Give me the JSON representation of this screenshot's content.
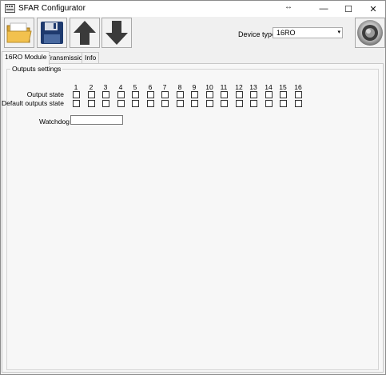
{
  "window": {
    "title": "SFAR Configurator",
    "resize_glyph": "↔",
    "controls": {
      "minimize": "—",
      "maximize": "☐",
      "close": "✕"
    }
  },
  "toolbar": {
    "buttons": [
      {
        "name": "open",
        "icon": "folder-open-icon"
      },
      {
        "name": "save",
        "icon": "floppy-disk-icon"
      },
      {
        "name": "upload",
        "icon": "arrow-up-icon"
      },
      {
        "name": "download",
        "icon": "arrow-down-icon"
      }
    ],
    "device_type_label": "Device type:",
    "device_type_value": "16RO",
    "device_type_arrow": "▾"
  },
  "tabs": [
    {
      "label": "16RO Module",
      "active": true
    },
    {
      "label": "Transmission",
      "active": false
    },
    {
      "label": "Info",
      "active": false
    }
  ],
  "outputs_settings": {
    "title": "Outputs settings",
    "columns": [
      "1",
      "2",
      "3",
      "4",
      "5",
      "6",
      "7",
      "8",
      "9",
      "10",
      "11",
      "12",
      "13",
      "14",
      "15",
      "16"
    ],
    "rows": [
      {
        "label": "Output state",
        "checked": [
          false,
          false,
          false,
          false,
          false,
          false,
          false,
          false,
          false,
          false,
          false,
          false,
          false,
          false,
          false,
          false
        ]
      },
      {
        "label": "Default outputs state",
        "checked": [
          false,
          false,
          false,
          false,
          false,
          false,
          false,
          false,
          false,
          false,
          false,
          false,
          false,
          false,
          false,
          false
        ]
      }
    ],
    "watchdog_label": "Watchdog",
    "watchdog_value": ""
  },
  "colors": {
    "toolbar_arrow": "#3a3a3a",
    "folder": "#f2c14e",
    "floppy": "#1e3a6e"
  }
}
